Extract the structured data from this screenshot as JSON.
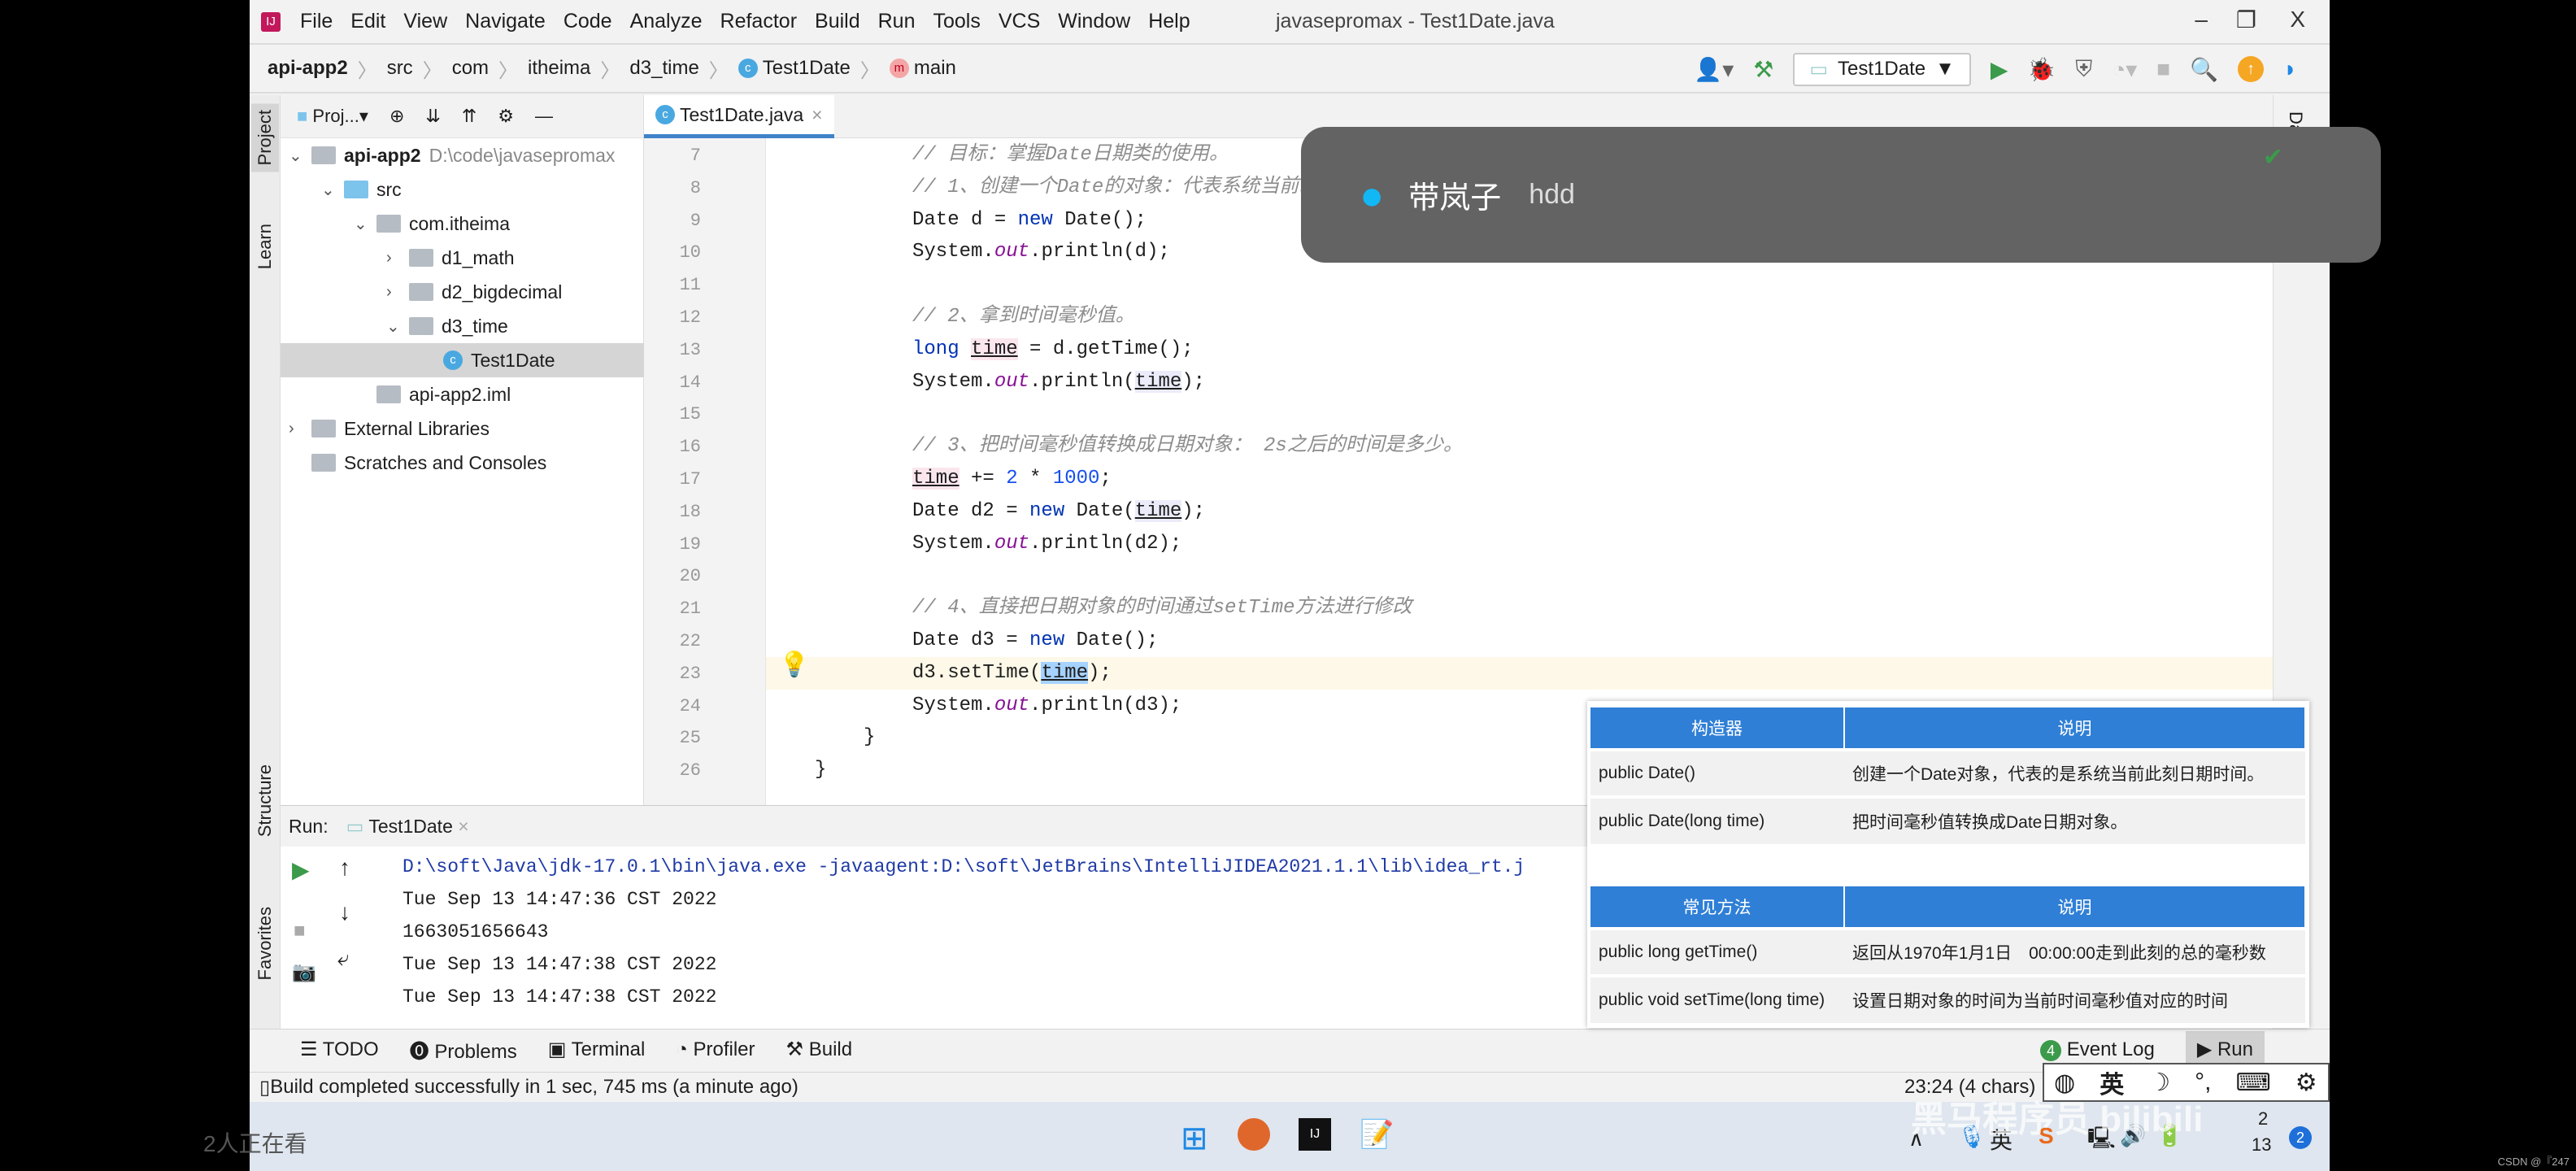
{
  "window": {
    "title": "javasepromax - Test1Date.java",
    "menu": [
      "File",
      "Edit",
      "View",
      "Navigate",
      "Code",
      "Analyze",
      "Refactor",
      "Build",
      "Run",
      "Tools",
      "VCS",
      "Window",
      "Help"
    ],
    "controls": {
      "minimize": "–",
      "restore": "❐",
      "close": "X"
    }
  },
  "breadcrumb": [
    "api-app2",
    "src",
    "com",
    "itheima",
    "d3_time",
    "Test1Date",
    "main"
  ],
  "toolbar": {
    "run_config": "Test1Date"
  },
  "left_strip": [
    "Project",
    "Learn",
    "Structure",
    "Favorites"
  ],
  "right_strip": [
    "Database"
  ],
  "project": {
    "header": "Proj...",
    "tree": [
      {
        "label": "api-app2",
        "path": "D:\\code\\javasepromax",
        "depth": 0,
        "expanded": true
      },
      {
        "label": "src",
        "depth": 1,
        "expanded": true
      },
      {
        "label": "com.itheima",
        "depth": 2,
        "expanded": true
      },
      {
        "label": "d1_math",
        "depth": 3,
        "expanded": false
      },
      {
        "label": "d2_bigdecimal",
        "depth": 3,
        "expanded": false
      },
      {
        "label": "d3_time",
        "depth": 3,
        "expanded": true
      },
      {
        "label": "Test1Date",
        "depth": 4,
        "selected": true
      },
      {
        "label": "api-app2.iml",
        "depth": 2
      },
      {
        "label": "External Libraries",
        "depth": 0,
        "expanded": false
      },
      {
        "label": "Scratches and Consoles",
        "depth": 0
      }
    ]
  },
  "editor": {
    "tab": "Test1Date.java",
    "current_line": 23,
    "lines": [
      {
        "n": 7,
        "tokens": [
          [
            "cm",
            "// 目标：掌握Date日期类的使用。"
          ]
        ]
      },
      {
        "n": 8,
        "tokens": [
          [
            "cm",
            "// 1、创建一个Date的对象：代表系统当前时间信息的。"
          ]
        ]
      },
      {
        "n": 9,
        "tokens": [
          [
            "",
            "Date d = "
          ],
          [
            "kw",
            "new"
          ],
          [
            "",
            " Date();"
          ]
        ]
      },
      {
        "n": 10,
        "tokens": [
          [
            "",
            "System."
          ],
          [
            "st",
            "out"
          ],
          [
            "",
            ".println(d);"
          ]
        ]
      },
      {
        "n": 11,
        "tokens": []
      },
      {
        "n": 12,
        "tokens": [
          [
            "cm",
            "// 2、拿到时间毫秒值。"
          ]
        ]
      },
      {
        "n": 13,
        "tokens": [
          [
            "kw",
            "long"
          ],
          [
            "",
            " "
          ],
          [
            "var",
            "time"
          ],
          [
            "",
            " = d.getTime();"
          ]
        ]
      },
      {
        "n": 14,
        "tokens": [
          [
            "",
            "System."
          ],
          [
            "st",
            "out"
          ],
          [
            "",
            ".println("
          ],
          [
            "var2",
            "time"
          ],
          [
            "",
            ");"
          ]
        ]
      },
      {
        "n": 15,
        "tokens": []
      },
      {
        "n": 16,
        "tokens": [
          [
            "cm",
            "// 3、把时间毫秒值转换成日期对象： 2s之后的时间是多少。"
          ]
        ]
      },
      {
        "n": 17,
        "tokens": [
          [
            "var",
            "time"
          ],
          [
            "",
            " += "
          ],
          [
            "num",
            "2"
          ],
          [
            "",
            " * "
          ],
          [
            "num",
            "1000"
          ],
          [
            "",
            ";"
          ]
        ]
      },
      {
        "n": 18,
        "tokens": [
          [
            "",
            "Date d2 = "
          ],
          [
            "kw",
            "new"
          ],
          [
            "",
            " Date("
          ],
          [
            "var2",
            "time"
          ],
          [
            "",
            ");"
          ]
        ]
      },
      {
        "n": 19,
        "tokens": [
          [
            "",
            "System."
          ],
          [
            "st",
            "out"
          ],
          [
            "",
            ".println(d2);"
          ]
        ]
      },
      {
        "n": 20,
        "tokens": []
      },
      {
        "n": 21,
        "tokens": [
          [
            "cm",
            "// 4、直接把日期对象的时间通过setTime方法进行修改"
          ]
        ]
      },
      {
        "n": 22,
        "tokens": [
          [
            "",
            "Date d3 = "
          ],
          [
            "kw",
            "new"
          ],
          [
            "",
            " Date();"
          ]
        ]
      },
      {
        "n": 23,
        "tokens": [
          [
            "",
            "d3.setTime("
          ],
          [
            "sel",
            "time"
          ],
          [
            "",
            ");"
          ]
        ]
      },
      {
        "n": 24,
        "tokens": [
          [
            "",
            "System."
          ],
          [
            "st",
            "out"
          ],
          [
            "",
            ".println(d3);"
          ]
        ]
      },
      {
        "n": 25,
        "tokens": [
          [
            "",
            "}"
          ]
        ],
        "indent": -1
      },
      {
        "n": 26,
        "tokens": [
          [
            "",
            "}"
          ]
        ],
        "indent": -2
      }
    ]
  },
  "run": {
    "label": "Run:",
    "tab": "Test1Date",
    "output": [
      "D:\\soft\\Java\\jdk-17.0.1\\bin\\java.exe -javaagent:D:\\soft\\JetBrains\\IntelliJIDEA2021.1.1\\lib\\idea_rt.j",
      "Tue Sep 13 14:47:36 CST 2022",
      "1663051656643",
      "Tue Sep 13 14:47:38 CST 2022",
      "Tue Sep 13 14:47:38 CST 2022"
    ]
  },
  "bottom_tabs": [
    "TODO",
    "Problems",
    "Terminal",
    "Profiler",
    "Build"
  ],
  "bottom_right": {
    "event_log_count": "4",
    "event_log": "Event Log",
    "run": "Run"
  },
  "status": {
    "message": "Build completed successfully in 1 sec, 745 ms (a minute ago)",
    "position": "23:24 (4 chars)"
  },
  "notification": {
    "name": "带岚子",
    "text": "hdd"
  },
  "reference_table": {
    "constructors": {
      "headers": [
        "构造器",
        "说明"
      ],
      "rows": [
        [
          "public Date()",
          "创建一个Date对象，代表的是系统当前此刻日期时间。"
        ],
        [
          "public Date(long time)",
          "把时间毫秒值转换成Date日期对象。"
        ]
      ]
    },
    "methods": {
      "headers": [
        "常见方法",
        "说明"
      ],
      "rows": [
        [
          "public long getTime()",
          "返回从1970年1月1日　00:00:00走到此刻的总的毫秒数"
        ],
        [
          "public void setTime(long time)",
          "设置日期对象的时间为当前时间毫秒值对应的时间"
        ]
      ]
    }
  },
  "ime": {
    "lang": "英"
  },
  "taskbar": {
    "tray_lang": "英",
    "date_top": "2",
    "date_bottom": "13",
    "notif_count": "2"
  },
  "overlay": {
    "watching": "2人正在看",
    "watermark": "黑马程序员 bilibili",
    "credit": "CSDN @『247"
  },
  "colors": {
    "accent": "#2f7fd6",
    "run_green": "#3c9a4b",
    "notif_bg": "#636363"
  }
}
